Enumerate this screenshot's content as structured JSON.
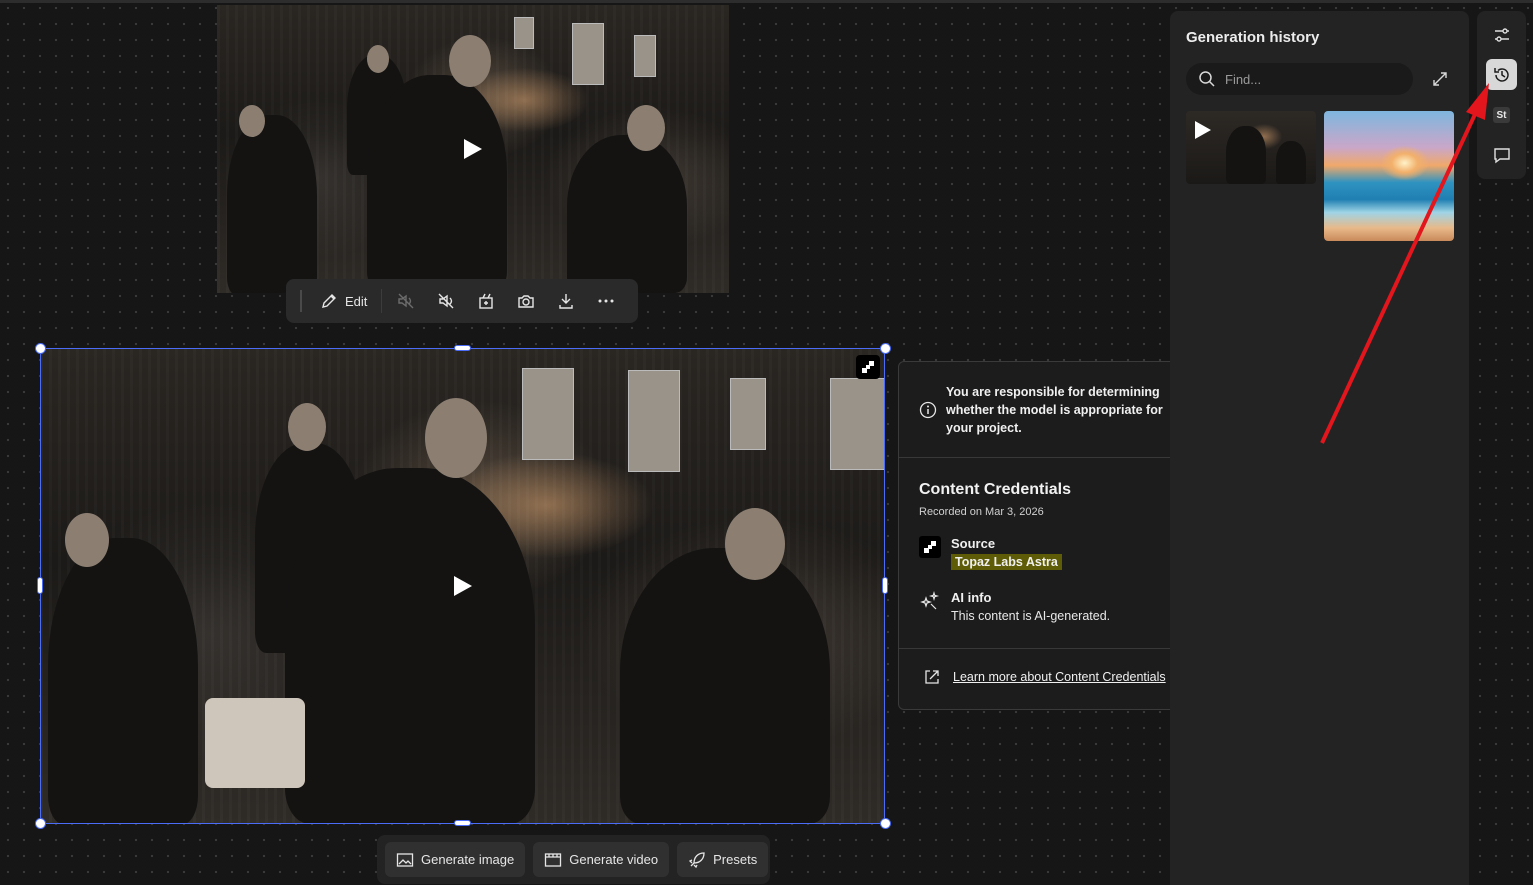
{
  "toolbar": {
    "edit_label": "Edit"
  },
  "bottombar": {
    "generate_image": "Generate image",
    "generate_video": "Generate video",
    "presets": "Presets"
  },
  "popover": {
    "warning": "You are responsible for determining whether the model is appropriate for your project.",
    "cc_title": "Content Credentials",
    "cc_recorded": "Recorded on Mar 3, 2026",
    "source_label": "Source",
    "source_value": "Topaz Labs Astra",
    "ai_label": "AI info",
    "ai_value": "This content is AI-generated.",
    "learn_more": "Learn more about Content Credentials"
  },
  "panel": {
    "title": "Generation history",
    "search_placeholder": "Find..."
  },
  "rail": {
    "badge": "St"
  },
  "colors": {
    "selection": "#4a6cf7",
    "highlight": "#5e5c06",
    "annotation_arrow": "#e3151d",
    "canvas_bg": "#161616"
  },
  "icons": [
    "pencil-icon",
    "audio-off-icon",
    "mute-icon",
    "extend-icon",
    "camera-icon",
    "download-icon",
    "more-icon",
    "image-icon",
    "video-icon",
    "rocket-icon",
    "info-icon",
    "ai-sparkle-icon",
    "external-link-icon",
    "search-icon",
    "expand-icon",
    "sliders-icon",
    "history-icon",
    "chat-icon",
    "play-icon"
  ]
}
